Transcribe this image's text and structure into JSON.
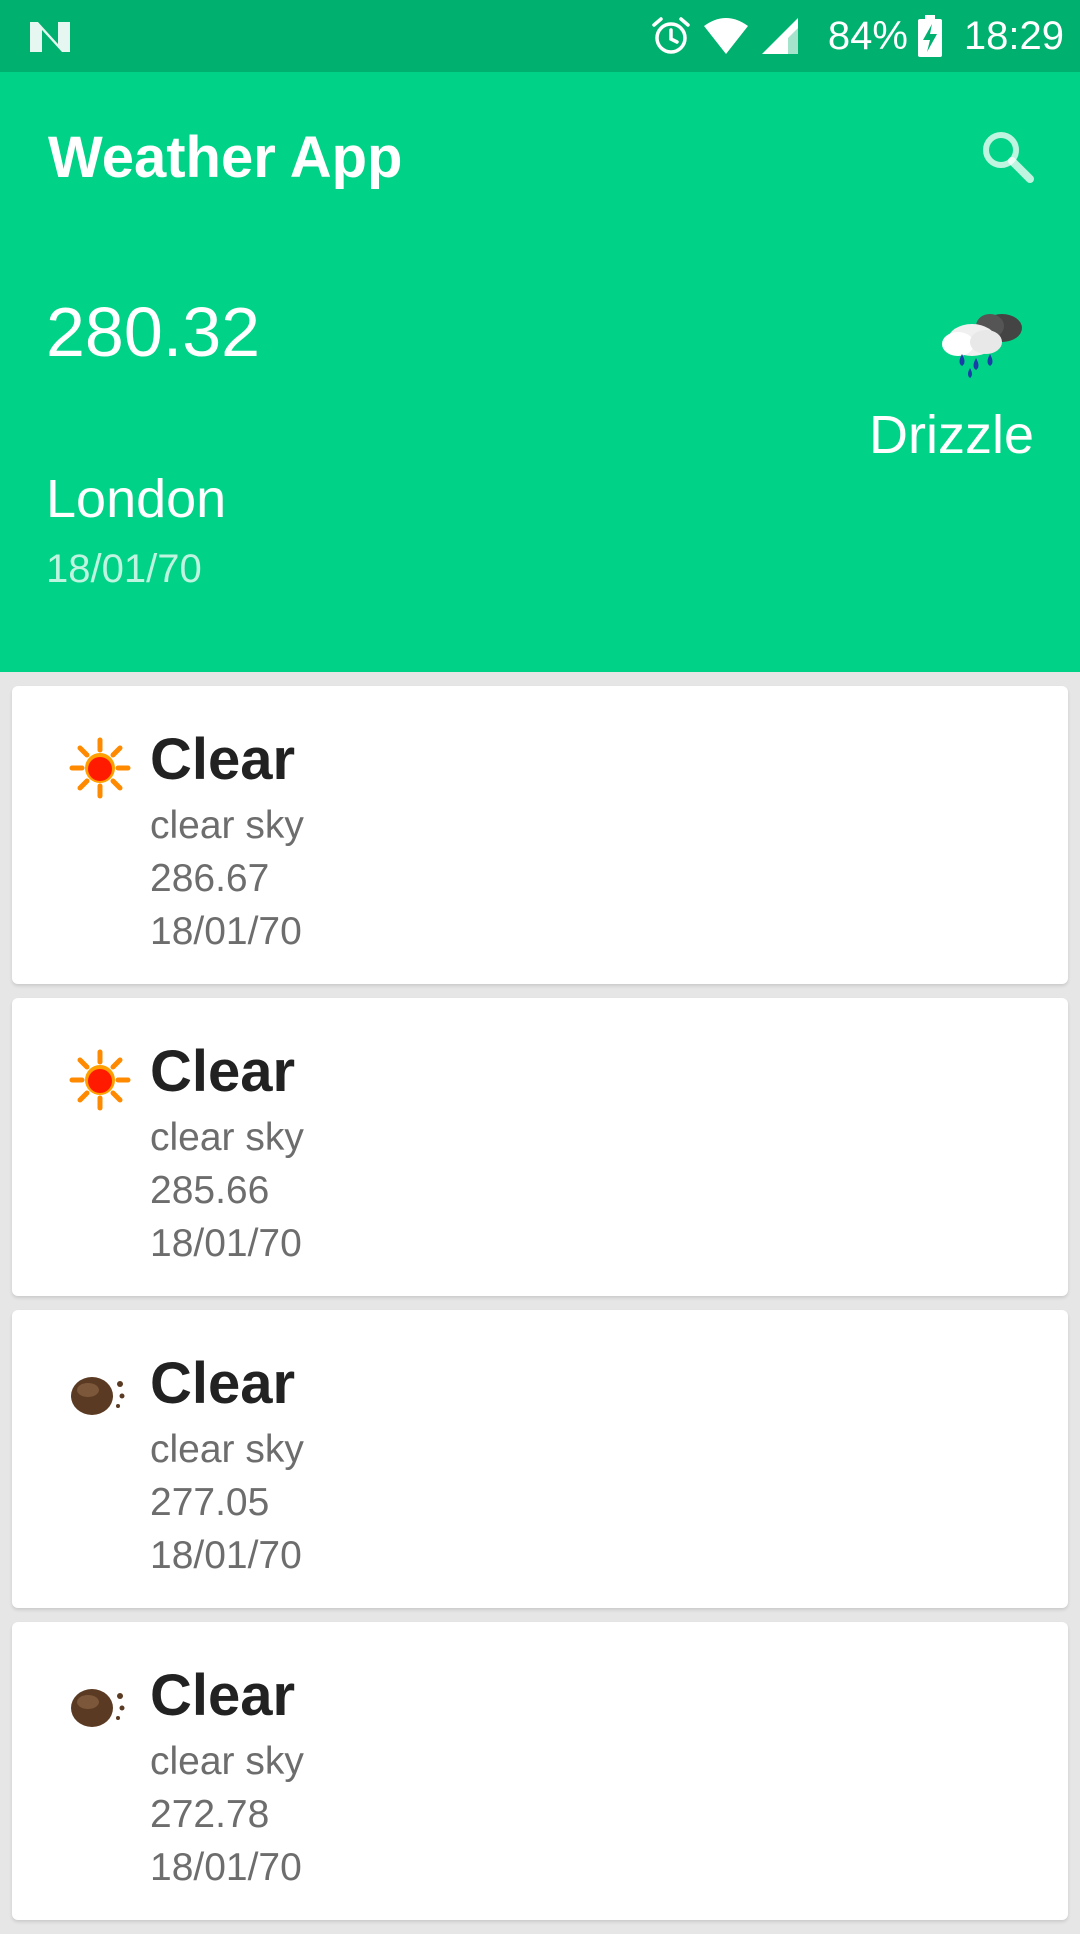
{
  "status_bar": {
    "battery_percent": "84%",
    "time": "18:29",
    "icons": [
      "notification-n-icon",
      "alarm-icon",
      "wifi-icon",
      "signal-icon",
      "battery-charging-icon"
    ]
  },
  "app_bar": {
    "title": "Weather App",
    "search_icon": "search-icon"
  },
  "current": {
    "temperature": "280.32",
    "condition": "Drizzle",
    "condition_icon": "rain-cloud-icon",
    "city": "London",
    "date": "18/01/70"
  },
  "forecast": [
    {
      "title": "Clear",
      "description": "clear sky",
      "temperature": "286.67",
      "date": "18/01/70",
      "icon": "sun-icon"
    },
    {
      "title": "Clear",
      "description": "clear sky",
      "temperature": "285.66",
      "date": "18/01/70",
      "icon": "sun-icon"
    },
    {
      "title": "Clear",
      "description": "clear sky",
      "temperature": "277.05",
      "date": "18/01/70",
      "icon": "moon-icon"
    },
    {
      "title": "Clear",
      "description": "clear sky",
      "temperature": "272.78",
      "date": "18/01/70",
      "icon": "moon-icon"
    }
  ],
  "colors": {
    "status_bar": "#00b06e",
    "app_bar": "#00d388",
    "background": "#e6e6e6",
    "card": "#ffffff"
  }
}
